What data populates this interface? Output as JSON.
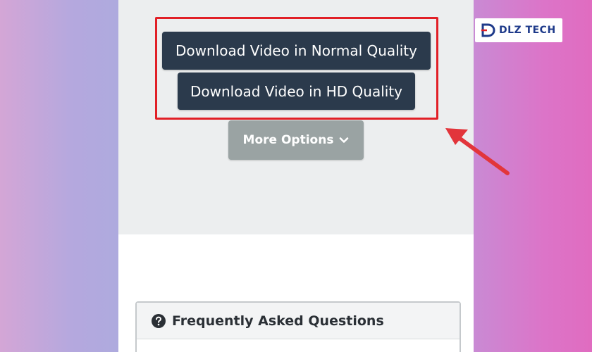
{
  "buttons": {
    "normal_quality": "Download Video in Normal Quality",
    "hd_quality": "Download Video in HD Quality",
    "more_options": "More Options"
  },
  "faq": {
    "title": "Frequently Asked Questions"
  },
  "logo": {
    "text": "DLZ TECH"
  },
  "colors": {
    "button_dark": "#2b3a4c",
    "button_gray": "#9aa3a3",
    "highlight": "#e11f26",
    "arrow": "#e2353b",
    "logo": "#1e3a8a"
  },
  "icons": {
    "more_options": "chevron-down-icon",
    "faq": "question-circle-icon",
    "annotation": "arrow-icon"
  }
}
